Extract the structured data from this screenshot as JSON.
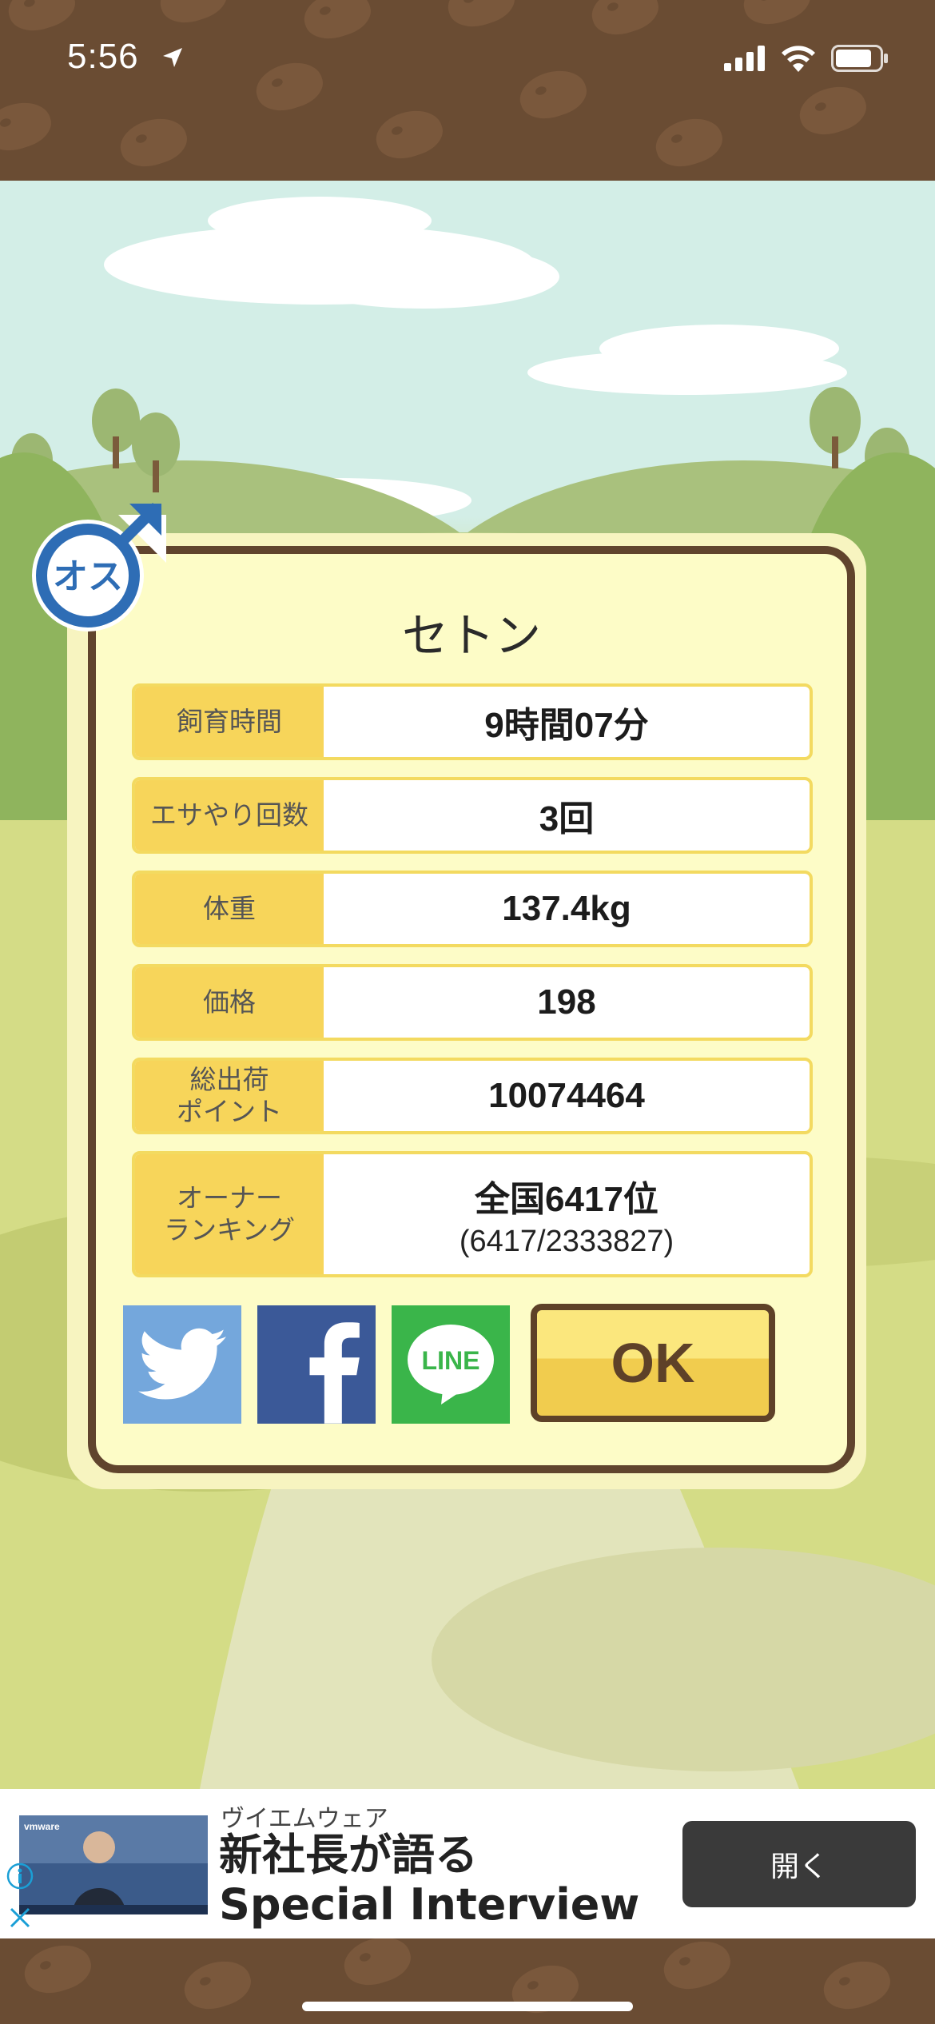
{
  "status_bar": {
    "time": "5:56"
  },
  "pig": {
    "name": "セトン",
    "gender_label": "オス"
  },
  "stats": [
    {
      "label": "飼育時間",
      "value": "9時間07分"
    },
    {
      "label": "エサやり回数",
      "value": "3回"
    },
    {
      "label": "体重",
      "value": "137.4kg"
    },
    {
      "label": "価格",
      "value": "198"
    },
    {
      "label": "総出荷\nポイント",
      "value": "10074464"
    },
    {
      "label": "オーナー\nランキング",
      "value": "全国6417位",
      "sub": "(6417/2333827)"
    }
  ],
  "share": {
    "line_label": "LINE",
    "ok_label": "OK"
  },
  "ad": {
    "brand": "ヴイエムウェア",
    "headline_line1": "新社長が語る",
    "headline_line2": "Special Interview",
    "open_button": "開く",
    "thumb_logo": "vmware"
  },
  "colors": {
    "twitter": "#74a7dc",
    "facebook": "#3b5998",
    "line": "#3ab54a",
    "label_bg": "#f7d55a",
    "frame": "#60442d"
  }
}
